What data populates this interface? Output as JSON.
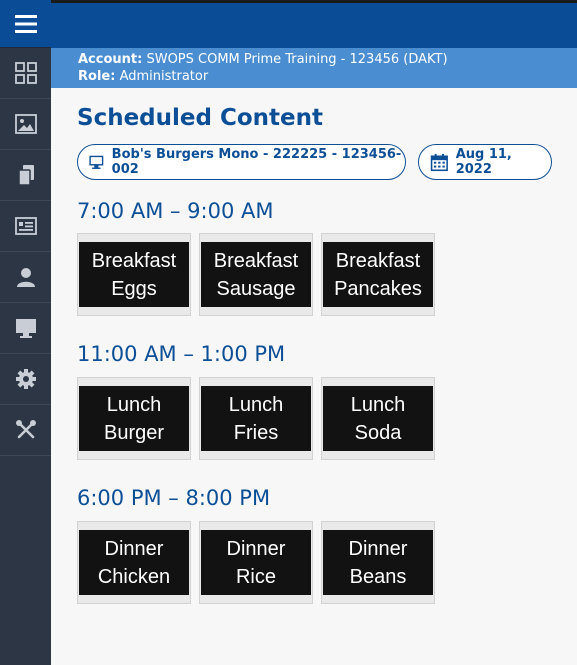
{
  "account": {
    "label": "Account:",
    "value": "SWOPS COMM Prime Training - 123456 (DAKT)"
  },
  "role": {
    "label": "Role:",
    "value": "Administrator"
  },
  "page_title": "Scheduled Content",
  "device_selector": {
    "label": "Bob's Burgers Mono - 222225 - 123456-002",
    "icon": "monitor-icon"
  },
  "date_selector": {
    "label": "Aug 11, 2022",
    "icon": "calendar-icon"
  },
  "sidebar": {
    "items": [
      {
        "name": "dashboard",
        "icon": "grid-icon"
      },
      {
        "name": "media",
        "icon": "image-icon"
      },
      {
        "name": "content",
        "icon": "document-icon"
      },
      {
        "name": "playlists",
        "icon": "id-card-icon"
      },
      {
        "name": "users",
        "icon": "user-icon"
      },
      {
        "name": "displays",
        "icon": "monitor-icon"
      },
      {
        "name": "settings",
        "icon": "gear-icon"
      },
      {
        "name": "tools",
        "icon": "tools-icon"
      }
    ]
  },
  "schedule": [
    {
      "time": "7:00 AM – 9:00 AM",
      "items": [
        {
          "line1": "Breakfast",
          "line2": "Eggs"
        },
        {
          "line1": "Breakfast",
          "line2": "Sausage"
        },
        {
          "line1": "Breakfast",
          "line2": "Pancakes"
        }
      ]
    },
    {
      "time": "11:00 AM – 1:00 PM",
      "items": [
        {
          "line1": "Lunch",
          "line2": "Burger"
        },
        {
          "line1": "Lunch",
          "line2": "Fries"
        },
        {
          "line1": "Lunch",
          "line2": "Soda"
        }
      ]
    },
    {
      "time": "6:00 PM – 8:00 PM",
      "items": [
        {
          "line1": "Dinner",
          "line2": "Chicken"
        },
        {
          "line1": "Dinner",
          "line2": "Rice"
        },
        {
          "line1": "Dinner",
          "line2": "Beans"
        }
      ]
    }
  ],
  "colors": {
    "brand": "#0a4d96",
    "info_bar": "#4a8ed1",
    "sidebar": "#2c3644",
    "accent_text": "#0d4f96"
  }
}
